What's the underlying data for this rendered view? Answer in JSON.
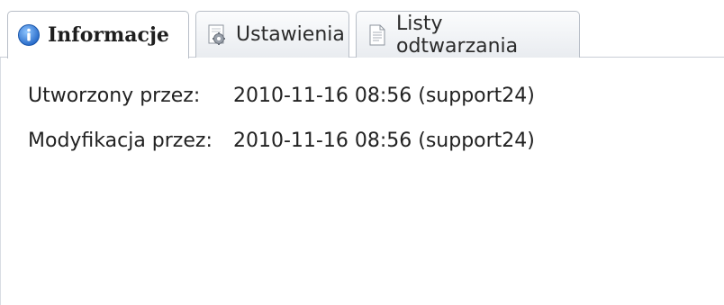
{
  "tabs": [
    {
      "label": "Informacje",
      "icon": "info-icon",
      "active": true
    },
    {
      "label": "Ustawienia",
      "icon": "settings-gear-icon",
      "active": false
    },
    {
      "label": "Listy odtwarzania",
      "icon": "document-icon",
      "active": false
    }
  ],
  "info": {
    "created_label": "Utworzony przez:",
    "created_value": "2010-11-16 08:56 (support24)",
    "modified_label": "Modyfikacja przez:",
    "modified_value": "2010-11-16 08:56 (support24)"
  },
  "colors": {
    "info_icon": "#2f7fd6",
    "tab_border": "#b8bec7"
  }
}
